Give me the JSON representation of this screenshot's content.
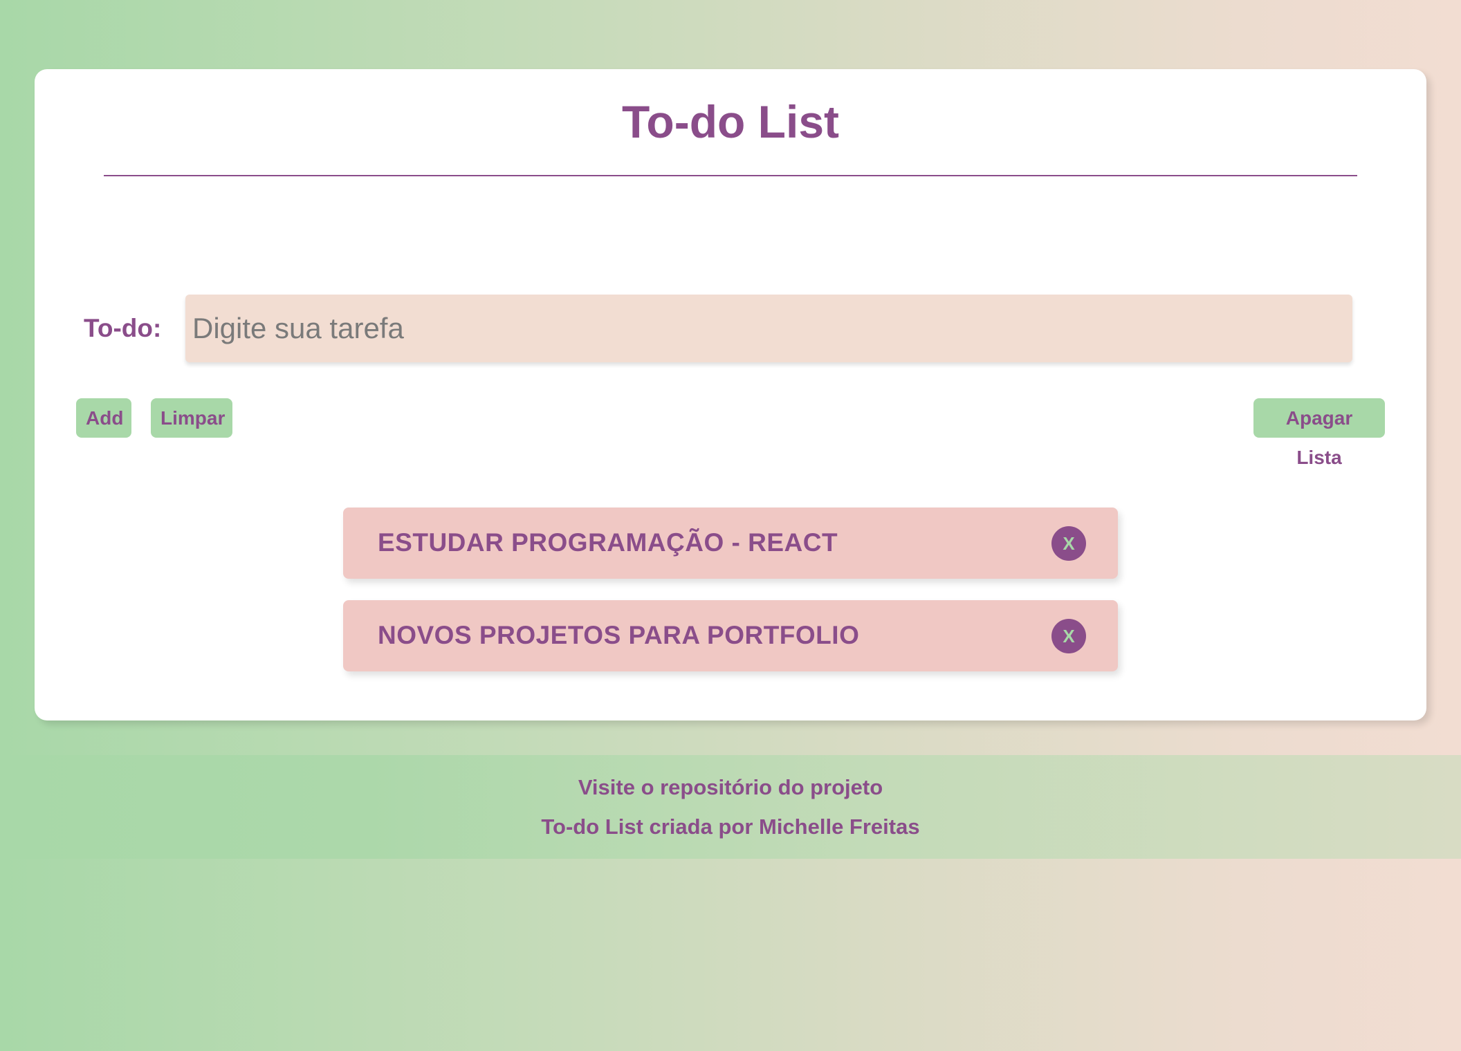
{
  "header": {
    "title": "To-do List"
  },
  "form": {
    "label": "To-do:",
    "input_placeholder": "Digite sua tarefa",
    "input_value": ""
  },
  "buttons": {
    "add": "Add",
    "clear": "Limpar",
    "delete_list": "Apagar Lista"
  },
  "tasks": [
    {
      "text": "ESTUDAR PROGRAMAÇÃO - REACT",
      "remove_label": "X"
    },
    {
      "text": "NOVOS PROJETOS PARA PORTFOLIO",
      "remove_label": "X"
    }
  ],
  "footer": {
    "repo_link": "Visite o repositório do projeto",
    "credit": "To-do List criada por Michelle Freitas"
  },
  "colors": {
    "accent": "#8a4d8a",
    "button_bg": "#a8d8a8",
    "input_bg": "#f2ddd2",
    "task_bg": "#f0c8c4"
  }
}
